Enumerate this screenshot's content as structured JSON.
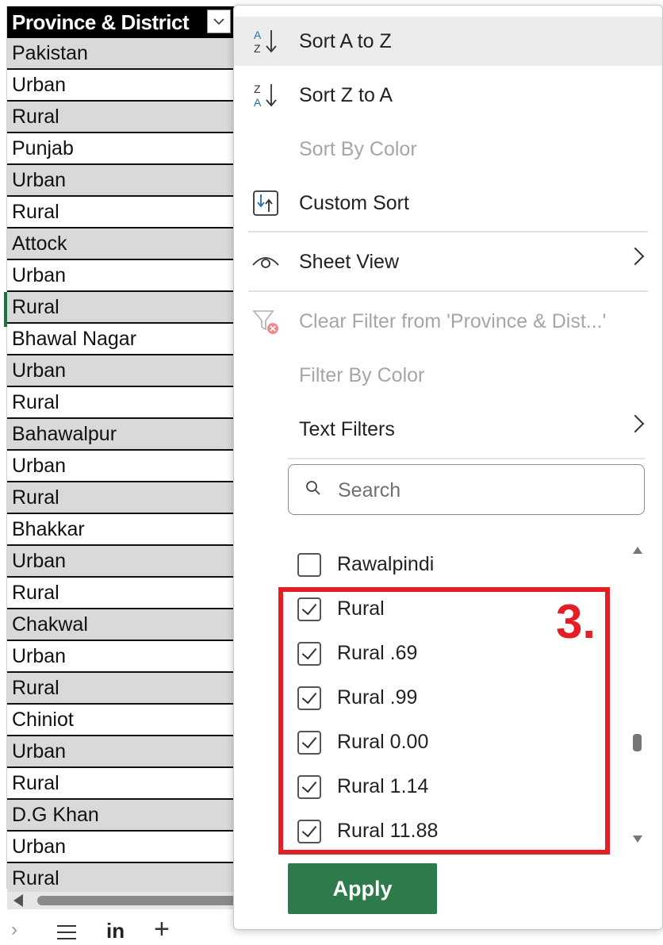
{
  "sheet": {
    "header": "Province & District",
    "rows": [
      "Pakistan",
      "Urban",
      "Rural",
      "Punjab",
      "Urban",
      "Rural",
      "Attock",
      "Urban",
      "Rural",
      "Bhawal Nagar",
      "Urban",
      "Rural",
      "Bahawalpur",
      "Urban",
      "Rural",
      "Bhakkar",
      "Urban",
      "Rural",
      "Chakwal",
      "Urban",
      "Rural",
      "Chiniot",
      "Urban",
      "Rural",
      "D.G Khan",
      "Urban",
      "Rural"
    ],
    "sheet_tab": "in"
  },
  "menu": {
    "sort_az": "Sort A to Z",
    "sort_za": "Sort Z to A",
    "sort_by_color": "Sort By Color",
    "custom_sort": "Custom Sort",
    "sheet_view": "Sheet View",
    "clear_filter": "Clear Filter from 'Province & Dist...'",
    "filter_by_color": "Filter By Color",
    "text_filters": "Text Filters",
    "search_placeholder": "Search",
    "items": [
      {
        "label": "Rawalpindi",
        "checked": false
      },
      {
        "label": "Rural",
        "checked": true
      },
      {
        "label": "Rural .69",
        "checked": true
      },
      {
        "label": "Rural .99",
        "checked": true
      },
      {
        "label": "Rural 0.00",
        "checked": true
      },
      {
        "label": "Rural 1.14",
        "checked": true
      },
      {
        "label": "Rural 11.88",
        "checked": true
      }
    ],
    "apply": "Apply"
  },
  "annotation": {
    "step_label": "3."
  },
  "colors": {
    "accent_green": "#2d7a4a",
    "annotation_red": "#e31e24",
    "header_bg": "#000000",
    "row_shade": "#d9d9d9"
  }
}
